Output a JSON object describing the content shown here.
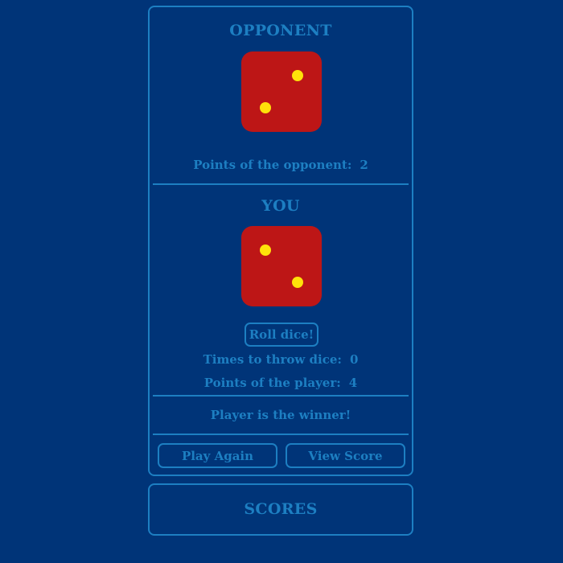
{
  "opponent": {
    "heading": "OPPONENT",
    "die_value": 2,
    "points_label": "Points of the opponent:",
    "points_value": "2"
  },
  "player": {
    "heading": "YOU",
    "die_value": 2,
    "roll_button": "Roll dice!",
    "throws_label": "Times to throw dice:",
    "throws_value": "0",
    "points_label": "Points of the player:",
    "points_value": "4"
  },
  "result": {
    "message": "Player is the winner!"
  },
  "actions": {
    "play_again": "Play Again",
    "view_score": "View Score"
  },
  "scores": {
    "heading": "SCORES"
  },
  "colors": {
    "background": "#003478",
    "accent": "#1d7fc2",
    "die_face": "#bd1616",
    "pip": "#ffe20a"
  }
}
